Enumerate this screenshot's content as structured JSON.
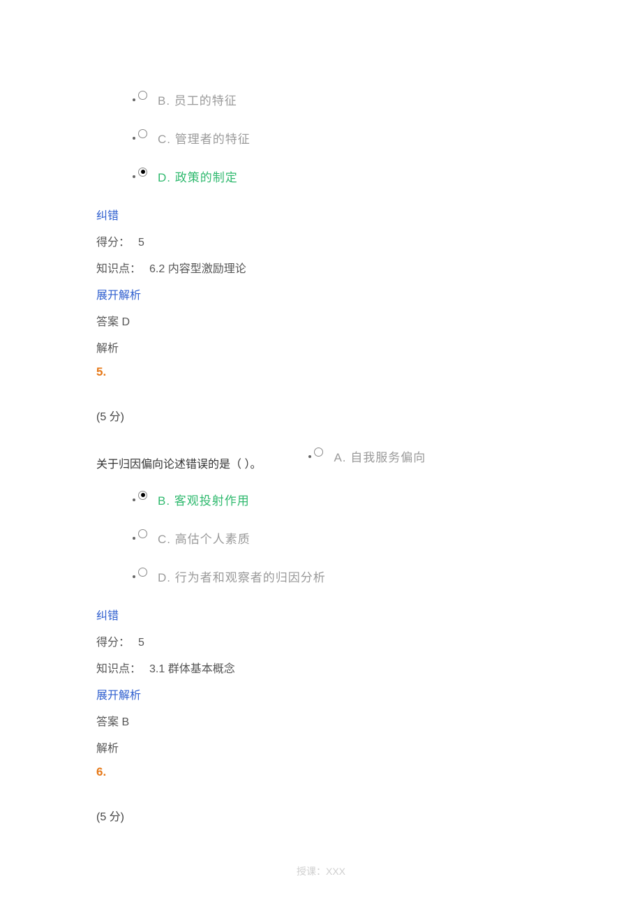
{
  "q4_tail": {
    "options": [
      {
        "letter": "B.",
        "text": "员工的特征",
        "selected": false
      },
      {
        "letter": "C.",
        "text": "管理者的特征",
        "selected": false
      },
      {
        "letter": "D.",
        "text": "政策的制定",
        "selected": true
      }
    ],
    "correct_link": "纠错",
    "score_label": "得分：",
    "score_value": "5",
    "kp_label": "知识点：",
    "kp_value": "6.2 内容型激励理论",
    "expand_link": "展开解析",
    "answer_label": "答案",
    "answer_value": "D",
    "analysis_label": "解析"
  },
  "q5": {
    "number": "5.",
    "points": "(5 分)",
    "stem": "关于归因偏向论述错误的是（ ）。",
    "optionA": {
      "letter": "A.",
      "text": "自我服务偏向",
      "selected": false
    },
    "options": [
      {
        "letter": "B.",
        "text": "客观投射作用",
        "selected": true
      },
      {
        "letter": "C.",
        "text": "高估个人素质",
        "selected": false
      },
      {
        "letter": "D.",
        "text": "行为者和观察者的归因分析",
        "selected": false
      }
    ],
    "correct_link": "纠错",
    "score_label": "得分：",
    "score_value": "5",
    "kp_label": "知识点：",
    "kp_value": "3.1 群体基本概念",
    "expand_link": "展开解析",
    "answer_label": "答案",
    "answer_value": "B",
    "analysis_label": "解析"
  },
  "q6": {
    "number": "6.",
    "points": "(5 分)"
  },
  "footer": "授课：XXX"
}
